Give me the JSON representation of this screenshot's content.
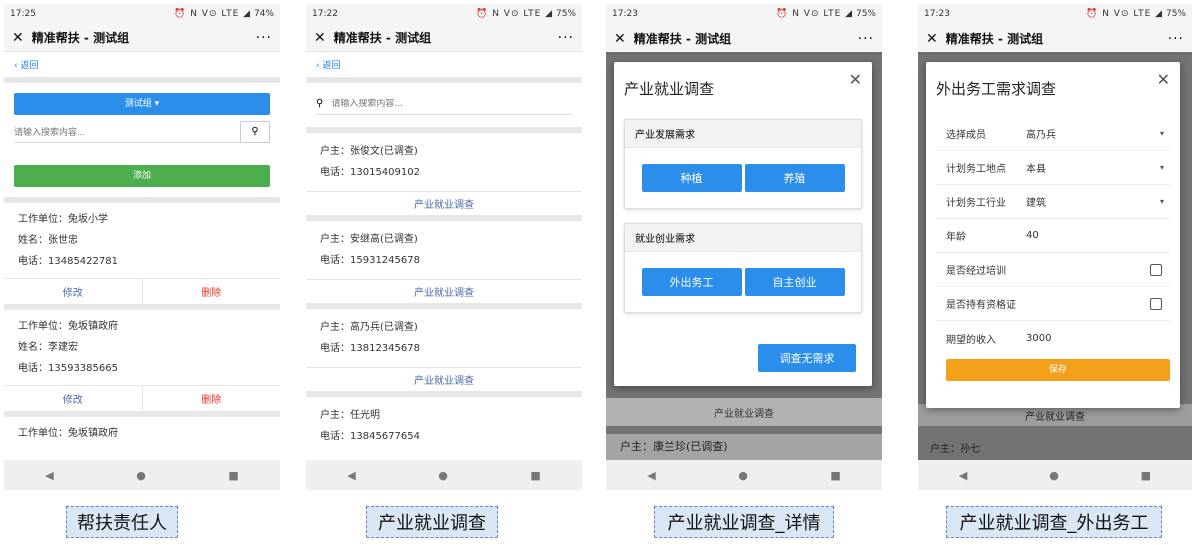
{
  "common": {
    "title": "精准帮扶 - 测试组",
    "back": "返回",
    "more": "···",
    "close": "✕",
    "status_icons": "⏰ N V⊙ LTE ◢",
    "search_placeholder": "请输入搜索内容..."
  },
  "phone1": {
    "time": "17:25",
    "battery": "74%",
    "group_dropdown": "测试组 ▾",
    "add_button": "添加",
    "cards": [
      {
        "work": "工作单位：兔坂小学",
        "name": "姓名：张世忠",
        "phone": "电话：13485422781"
      },
      {
        "work": "工作单位：兔坂镇政府",
        "name": "姓名：李建宏",
        "phone": "电话：13593385665"
      },
      {
        "work": "工作单位：兔坂镇政府"
      }
    ],
    "edit": "修改",
    "delete": "删除"
  },
  "phone2": {
    "time": "17:22",
    "battery": "75%",
    "survey_link": "产业就业调查",
    "households": [
      {
        "owner": "户主：张俊文(已调查)",
        "phone": "电话：13015409102"
      },
      {
        "owner": "户主：安继高(已调查)",
        "phone": "电话：15931245678"
      },
      {
        "owner": "户主：高乃兵(已调查)",
        "phone": "电话：13812345678"
      },
      {
        "owner": "户主：任光明",
        "phone": "电话：13845677654"
      }
    ]
  },
  "phone3": {
    "time": "17:23",
    "battery": "75%",
    "modal_title": "产业就业调查",
    "panel1_title": "产业发展需求",
    "panel1_options": [
      "种植",
      "养殖"
    ],
    "panel2_title": "就业创业需求",
    "panel2_options": [
      "外出务工",
      "自主创业"
    ],
    "no_need_button": "调查无需求",
    "bg_link": "产业就业调查",
    "bg_owner": "户主：康兰珍(已调查)"
  },
  "phone4": {
    "time": "17:23",
    "battery": "75%",
    "modal_title": "外出务工需求调查",
    "rows": [
      {
        "label": "选择成员",
        "value": "高乃兵"
      },
      {
        "label": "计划务工地点",
        "value": "本县"
      },
      {
        "label": "计划务工行业",
        "value": "建筑"
      },
      {
        "label": "年龄",
        "value": "40"
      },
      {
        "label": "是否经过培训",
        "value": ""
      },
      {
        "label": "是否持有资格证",
        "value": ""
      },
      {
        "label": "期望的收入",
        "value": "3000"
      }
    ],
    "save_button": "保存",
    "bg_link": "产业就业调查",
    "bg_owner": "户主：孙七"
  },
  "nav": {
    "back": "◀",
    "home": "●",
    "recent": "■"
  },
  "captions": [
    "帮扶责任人",
    "产业就业调查",
    "产业就业调查_详情",
    "产业就业调查_外出务工"
  ]
}
